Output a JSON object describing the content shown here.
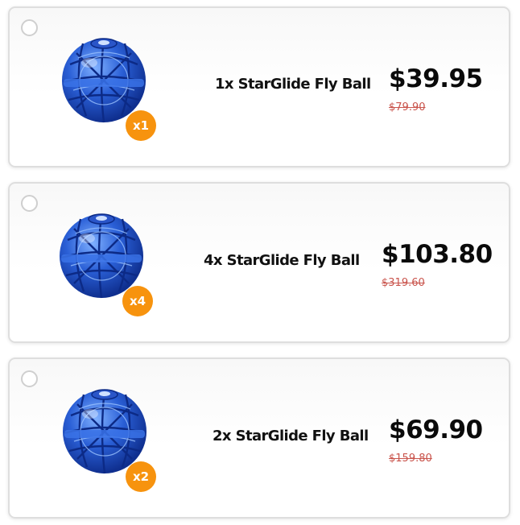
{
  "colors": {
    "badge": "#f7930e",
    "old_price": "#c9544c",
    "ball": "#1f55cf"
  },
  "offers": [
    {
      "name": "1x StarGlide Fly Ball",
      "price": "$39.95",
      "old_price": "$79.90",
      "badge": "x1",
      "selected": false,
      "image_icon": "blue-fly-ball"
    },
    {
      "name": "4x StarGlide Fly Ball",
      "price": "$103.80",
      "old_price": "$319.60",
      "badge": "x4",
      "selected": false,
      "image_icon": "blue-fly-ball"
    },
    {
      "name": "2x StarGlide Fly Ball",
      "price": "$69.90",
      "old_price": "$159.80",
      "badge": "x2",
      "selected": false,
      "image_icon": "blue-fly-ball"
    }
  ]
}
